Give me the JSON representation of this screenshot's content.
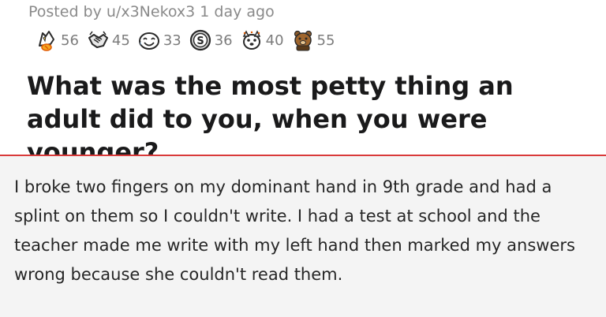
{
  "post": {
    "posted_by": "Posted by u/x3Nekox3 1 day ago",
    "awards": [
      {
        "icon": "wholesome-seal-icon",
        "count": "56"
      },
      {
        "icon": "handshake-icon",
        "count": "45"
      },
      {
        "icon": "face-with-tears-icon",
        "count": "33"
      },
      {
        "icon": "silver-coin-icon",
        "count": "36"
      },
      {
        "icon": "dog-face-icon",
        "count": "40"
      },
      {
        "icon": "gold-bear-icon",
        "count": "55"
      }
    ],
    "title": "What was the most petty thing an adult did to you, when you were younger?"
  },
  "comment": {
    "text": "I broke two fingers on my dominant hand in 9th grade and had a splint on them so I couldn't write. I had a test at school and the teacher made me write with my left hand then marked my answers wrong because she couldn't read them."
  },
  "colors": {
    "divider": "#d93a3a",
    "comment_background": "#f4f4f4",
    "meta_text": "#8a8a8a"
  }
}
